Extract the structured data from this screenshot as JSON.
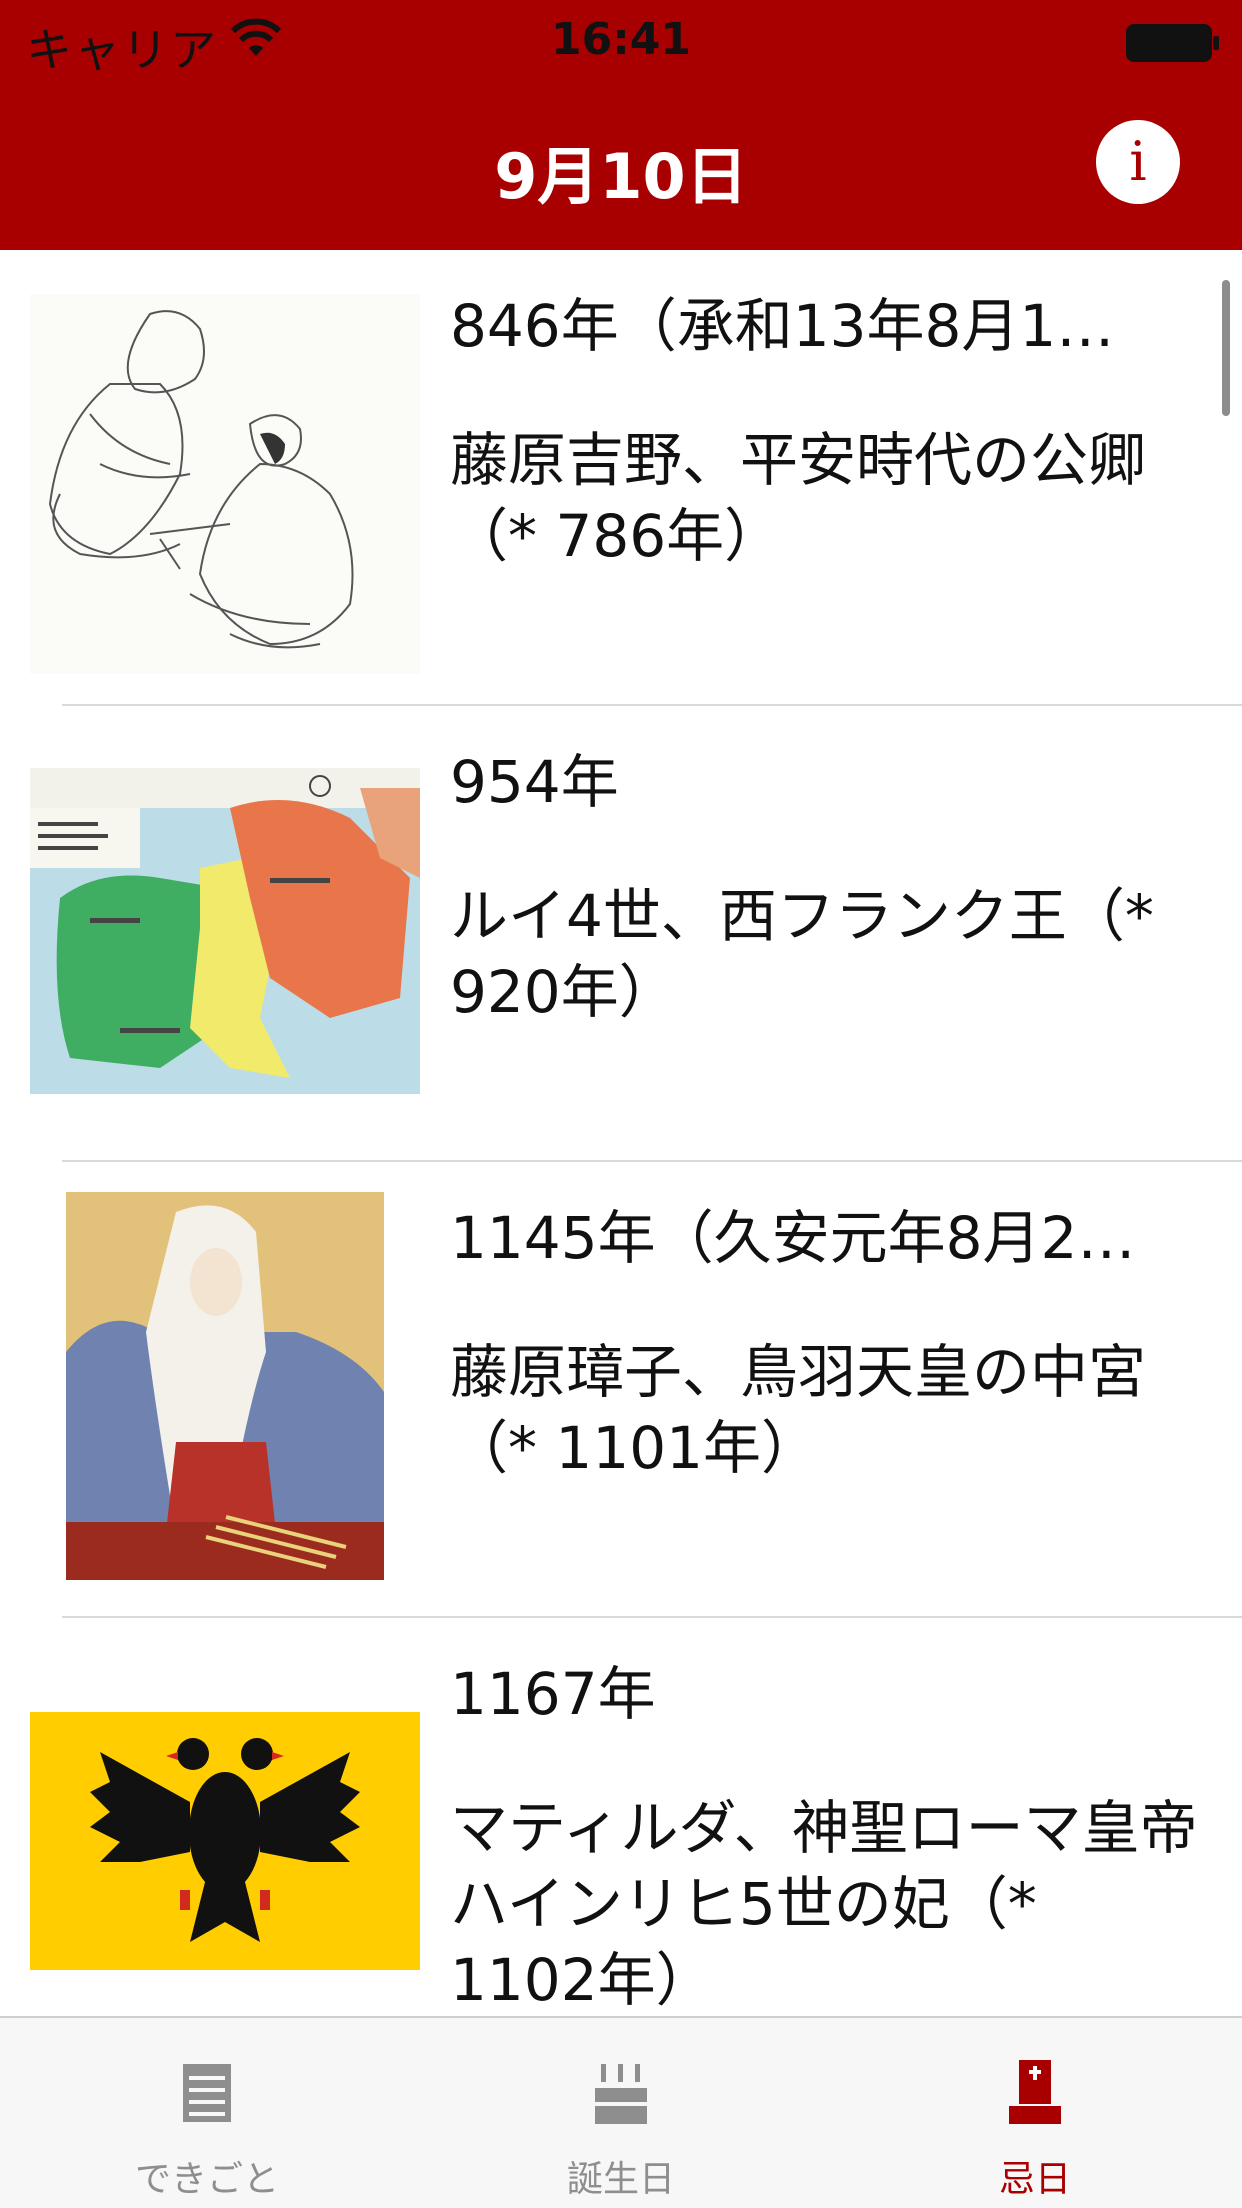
{
  "colors": {
    "accent": "#a80000"
  },
  "status_bar": {
    "carrier": "キャリア",
    "time": "16:41",
    "wifi_icon": "wifi-icon",
    "battery_icon": "battery-icon"
  },
  "nav": {
    "title": "9月10日",
    "info_label": "i"
  },
  "list": {
    "items": [
      {
        "year": "846年（承和13年8月1…",
        "description": "藤原吉野、平安時代の公卿（* 786年）",
        "thumbnail": "ink-sketch-portrait"
      },
      {
        "year": "954年",
        "description": "ルイ4世、西フランク王（* 920年）",
        "thumbnail": "map-of-frankish-kingdoms"
      },
      {
        "year": "1145年（久安元年8月2…",
        "description": "藤原璋子、鳥羽天皇の中宮（* 1101年）",
        "thumbnail": "painted-portrait"
      },
      {
        "year": "1167年",
        "description": "マティルダ、神聖ローマ皇帝ハインリヒ5世の妃（* 1102年）",
        "thumbnail": "double-headed-eagle-flag"
      }
    ]
  },
  "tabbar": {
    "tabs": [
      {
        "label": "できごと",
        "icon": "document-lines-icon",
        "active": false
      },
      {
        "label": "誕生日",
        "icon": "birthday-cake-icon",
        "active": false
      },
      {
        "label": "忌日",
        "icon": "gravestone-icon",
        "active": true
      }
    ]
  }
}
